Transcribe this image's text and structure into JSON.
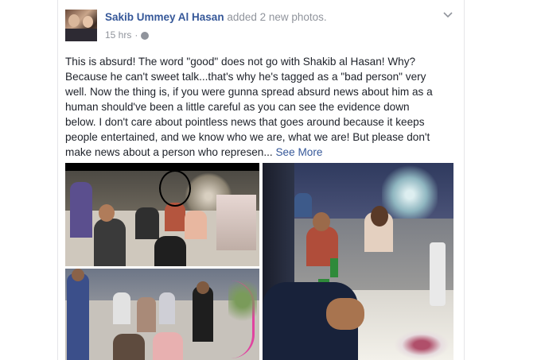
{
  "post": {
    "author": "Sakib Ummey Al Hasan",
    "action": " added 2 new photos.",
    "timestamp": "15 hrs",
    "separator": "·",
    "body": "This is absurd! The word \"good\" does not go with Shakib al Hasan! Why? Because he can't sweet talk...that's why he's tagged as a \"bad person\" very well. Now the thing is, if you were gunna spread absurd news about him as a human should've been a little careful as you can see the evidence down below. I don't care about pointless news that goes around because it keeps people entertained, and we know who we are, what we are! But please don't make news about a person who represen...",
    "see_more": " See More"
  },
  "icons": {
    "privacy": "globe-icon",
    "menu": "chevron-down-icon"
  },
  "colors": {
    "link": "#365899",
    "meta": "#90949c",
    "text": "#1d2129"
  }
}
